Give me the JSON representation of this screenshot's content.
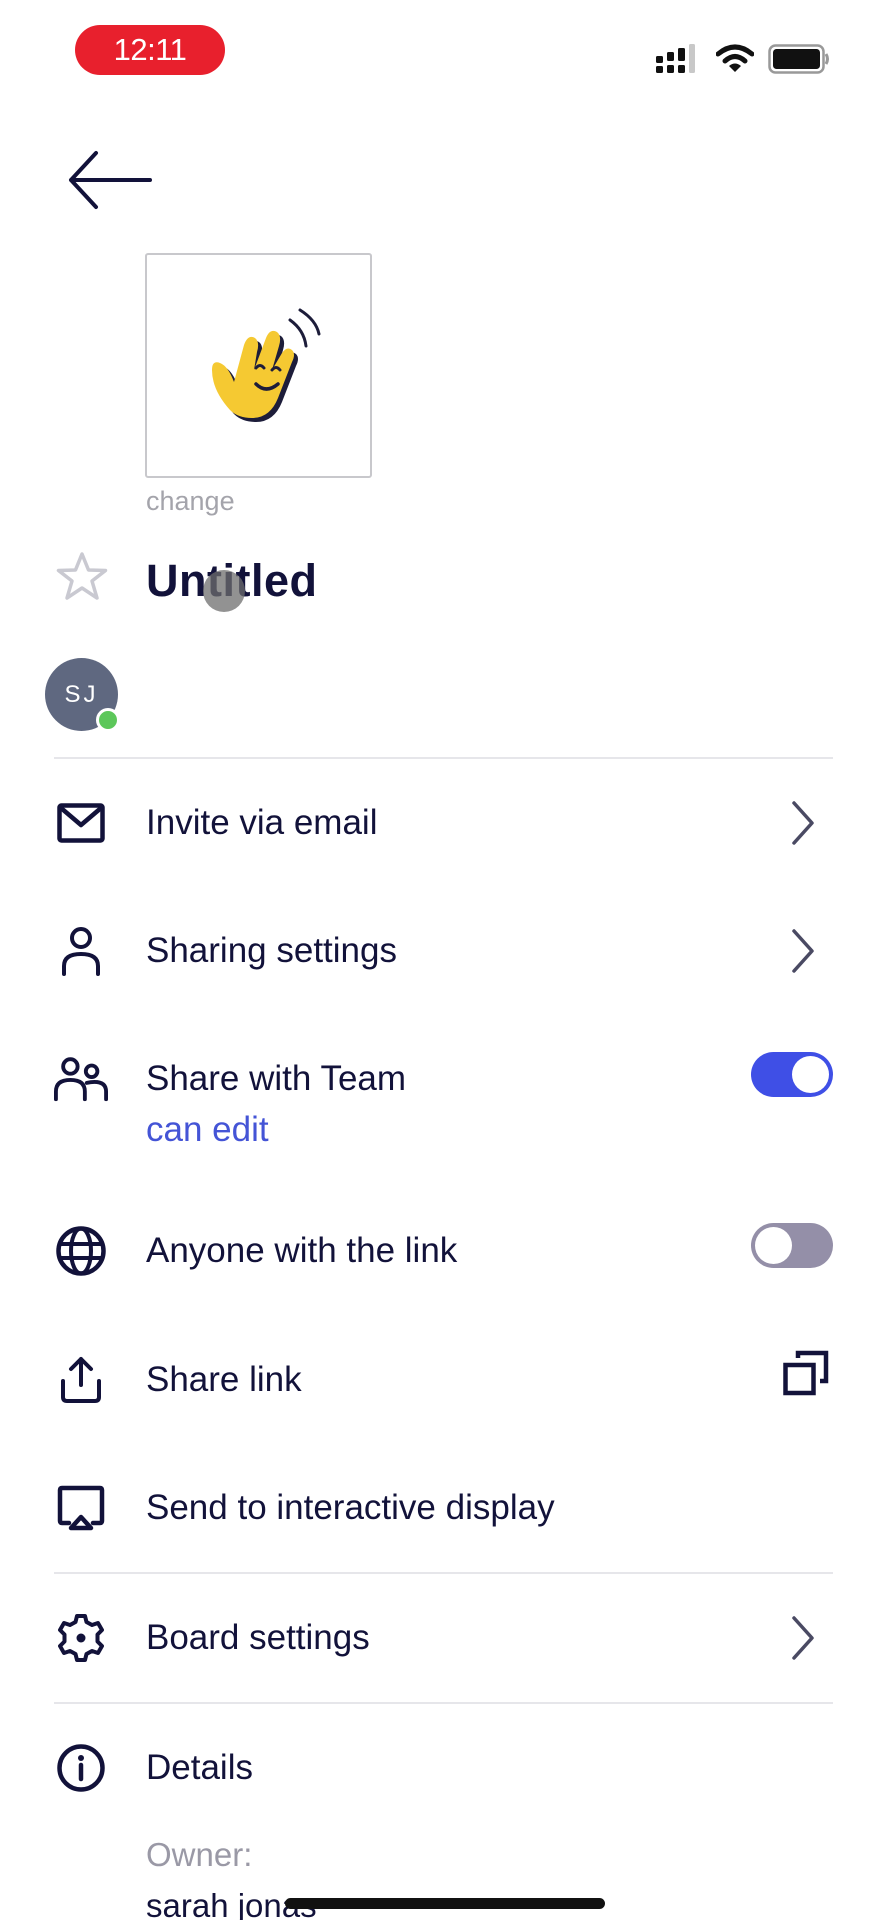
{
  "status_bar": {
    "time": "12:11",
    "icons": [
      "signal-icon",
      "wifi-icon",
      "battery-icon"
    ]
  },
  "header": {
    "back_icon": "arrow-left-icon"
  },
  "board": {
    "thumbnail_icon": "waving-hand-icon",
    "change_label": "change",
    "title": "Untitled",
    "favorite_icon": "star-outline-icon"
  },
  "collaborators": [
    {
      "initials": "SJ",
      "online": true
    }
  ],
  "menu": [
    {
      "id": "invite",
      "label": "Invite via email",
      "icon": "mail-icon",
      "trailing": "chevron"
    },
    {
      "id": "sharing",
      "label": "Sharing settings",
      "icon": "person-icon",
      "trailing": "chevron"
    },
    {
      "id": "team",
      "label": "Share with Team",
      "sublabel": "can edit",
      "icon": "people-icon",
      "trailing": "toggle",
      "toggle_on": true
    },
    {
      "id": "anyone",
      "label": "Anyone with the link",
      "icon": "globe-icon",
      "trailing": "toggle",
      "toggle_on": false
    },
    {
      "id": "sharelink",
      "label": "Share link",
      "icon": "share-upload-icon",
      "trailing": "copy"
    },
    {
      "id": "display",
      "label": "Send to interactive display",
      "icon": "airplay-icon",
      "trailing": "none"
    },
    {
      "id": "settings",
      "label": "Board settings",
      "icon": "gear-icon",
      "trailing": "chevron"
    },
    {
      "id": "details",
      "label": "Details",
      "icon": "info-icon",
      "trailing": "none"
    }
  ],
  "details": {
    "owner_label": "Owner:",
    "owner_name": "sarah jonas"
  },
  "colors": {
    "accent": "#3f4fe6",
    "link": "#4454d6",
    "text": "#12123a",
    "time_pill": "#e8202d",
    "toggle_off": "#948fa8",
    "presence": "#5cc75a"
  }
}
